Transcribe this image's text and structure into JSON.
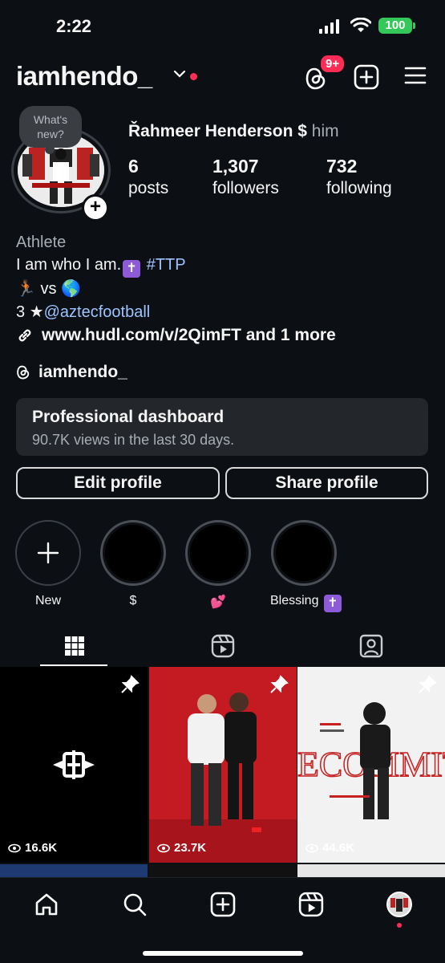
{
  "status_bar": {
    "time": "2:22",
    "battery": "100"
  },
  "header": {
    "username": "iamhendo_",
    "notification_badge": "9+"
  },
  "profile": {
    "note_text": "What's new?",
    "full_name": "Řahmeer Henderson $",
    "pronouns": "him",
    "stats": [
      {
        "value": "6",
        "label": "posts"
      },
      {
        "value": "1,307",
        "label": "followers"
      },
      {
        "value": "732",
        "label": "following"
      }
    ],
    "category": "Athlete",
    "bio_line1": "I am who I am.",
    "bio_hashtag": "#TTP",
    "bio_line2": "🏃🏾 vs 🌎",
    "bio_line3_prefix": "3 ★",
    "bio_mention": "@aztecfootball",
    "link": "www.hudl.com/v/2QimFT and 1 more",
    "threads_handle": "iamhendo_"
  },
  "dashboard": {
    "title": "Professional dashboard",
    "subtitle": "90.7K views in the last 30 days."
  },
  "buttons": {
    "edit": "Edit profile",
    "share": "Share profile"
  },
  "highlights": [
    {
      "label": "New"
    },
    {
      "label": "$"
    },
    {
      "label": "💕"
    },
    {
      "label": "Blessing"
    }
  ],
  "posts": [
    {
      "views": "16.6K"
    },
    {
      "views": "23.7K"
    },
    {
      "views": "44.6K"
    }
  ],
  "colors": {
    "background": "#0c0f14",
    "accent_red": "#ff2d55",
    "link_blue": "#9ec4ff",
    "battery_green": "#34c759"
  }
}
